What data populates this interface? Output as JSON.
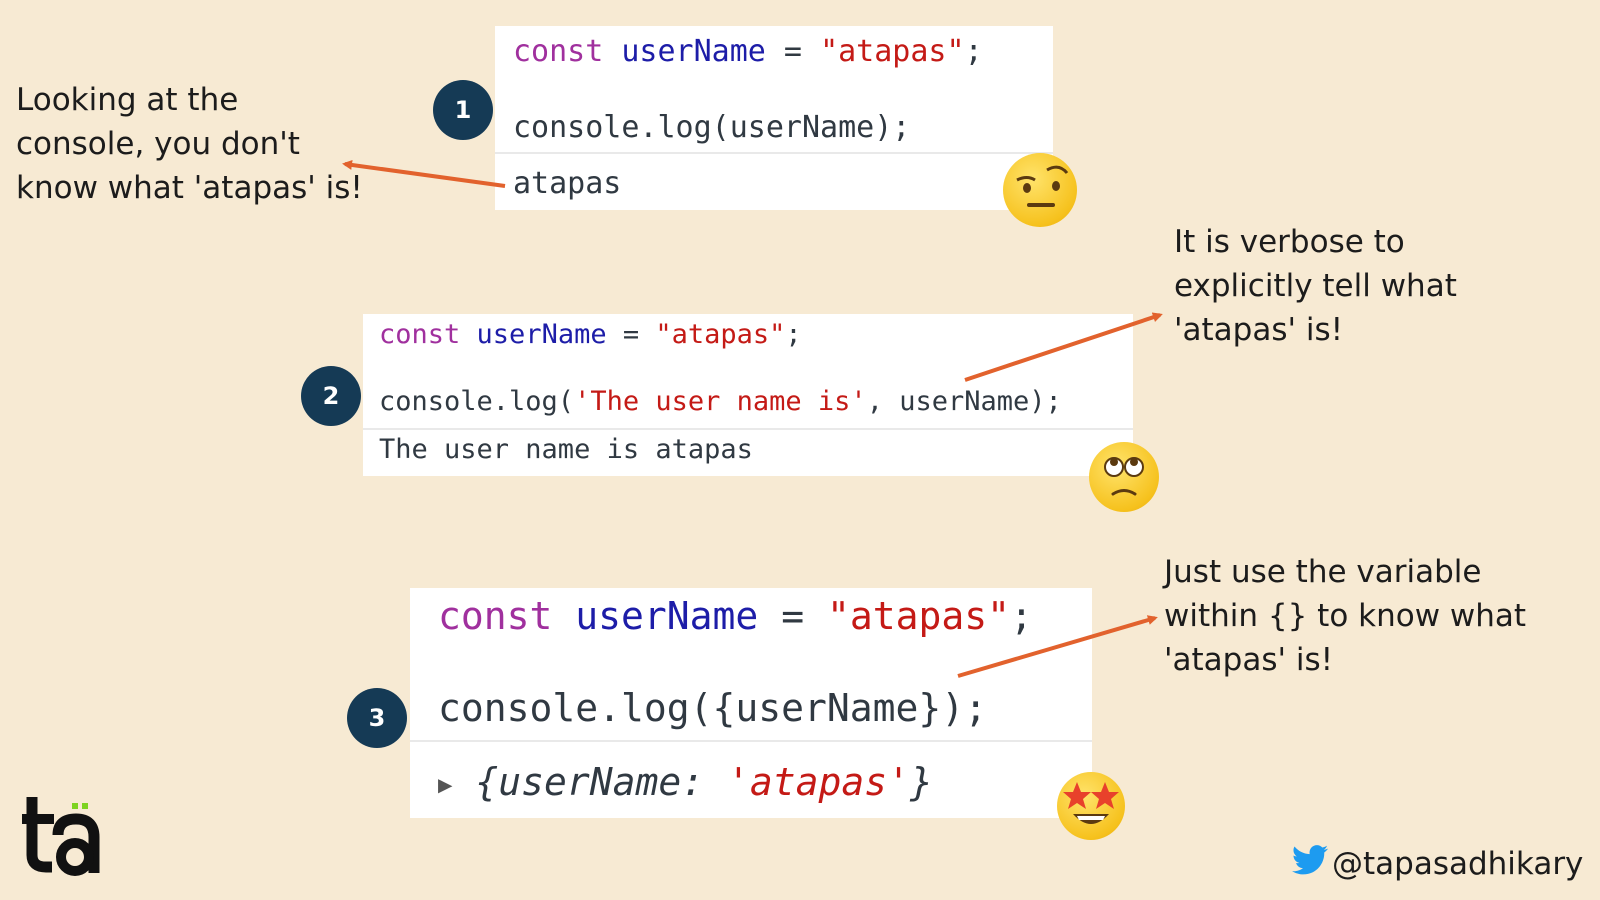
{
  "notes": {
    "note1": "Looking at the\nconsole, you don't\nknow what 'atapas' is!",
    "note2": "It is verbose to\nexplicitly tell what\n'atapas' is!",
    "note3": "Just use the variable\nwithin {} to know what\n'atapas' is!"
  },
  "badges": [
    "1",
    "2",
    "3"
  ],
  "panel1": {
    "line1": {
      "kw": "const",
      "id": "userName",
      "op": " = ",
      "str": "\"atapas\"",
      "end": ";"
    },
    "line2": "console.log(userName);",
    "output": "atapas"
  },
  "panel2": {
    "line1": {
      "kw": "const",
      "id": "userName",
      "op": " = ",
      "str": "\"atapas\"",
      "end": ";"
    },
    "line2": {
      "pre": "console.log(",
      "str": "'The user name is'",
      "post": ", userName);"
    },
    "output": "The user name is atapas"
  },
  "panel3": {
    "line1": {
      "kw": "const",
      "id": "userName",
      "op": " = ",
      "str": "\"atapas\"",
      "end": ";"
    },
    "line2": "console.log({userName});",
    "output": {
      "triangle": "▶",
      "open": "{userName: ",
      "str": "'atapas'",
      "close": "}"
    }
  },
  "emojis": [
    "face-with-raised-eyebrow",
    "face-with-rolling-eyes",
    "star-struck-face"
  ],
  "footer": {
    "handle": "@tapasadhikary",
    "icon": "twitter-bird-icon",
    "logo_letters": "ta"
  },
  "colors": {
    "background": "#f7ead3",
    "badge": "#153a55",
    "arrow": "#e2622d",
    "keyword": "#a0309e",
    "identifier": "#1d1da8",
    "string": "#c41a16",
    "logo_accent": "#7ed321"
  }
}
